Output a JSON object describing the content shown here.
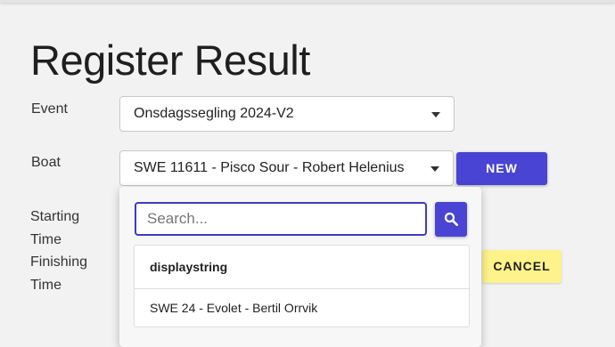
{
  "page": {
    "title": "Register Result"
  },
  "form": {
    "event_label": "Event",
    "event_value": "Onsdagssegling 2024-V2",
    "boat_label": "Boat",
    "boat_value": "SWE 11611 - Pisco Sour - Robert Helenius",
    "starting_label_line1": "Starting",
    "starting_label_line2": "Time",
    "finishing_label_line1": "Finishing",
    "finishing_label_line2": "Time"
  },
  "buttons": {
    "new_label": "NEW",
    "cancel_label": "CANCEL"
  },
  "dropdown": {
    "search_placeholder": "Search...",
    "search_icon": "search-icon",
    "options": [
      {
        "label": "displaystring"
      },
      {
        "label": "SWE 24 - Evolet - Bertil Orrvik"
      }
    ]
  },
  "colors": {
    "primary": "#4a44d4",
    "cancel": "#fef28a",
    "background": "#f2f2f2"
  }
}
